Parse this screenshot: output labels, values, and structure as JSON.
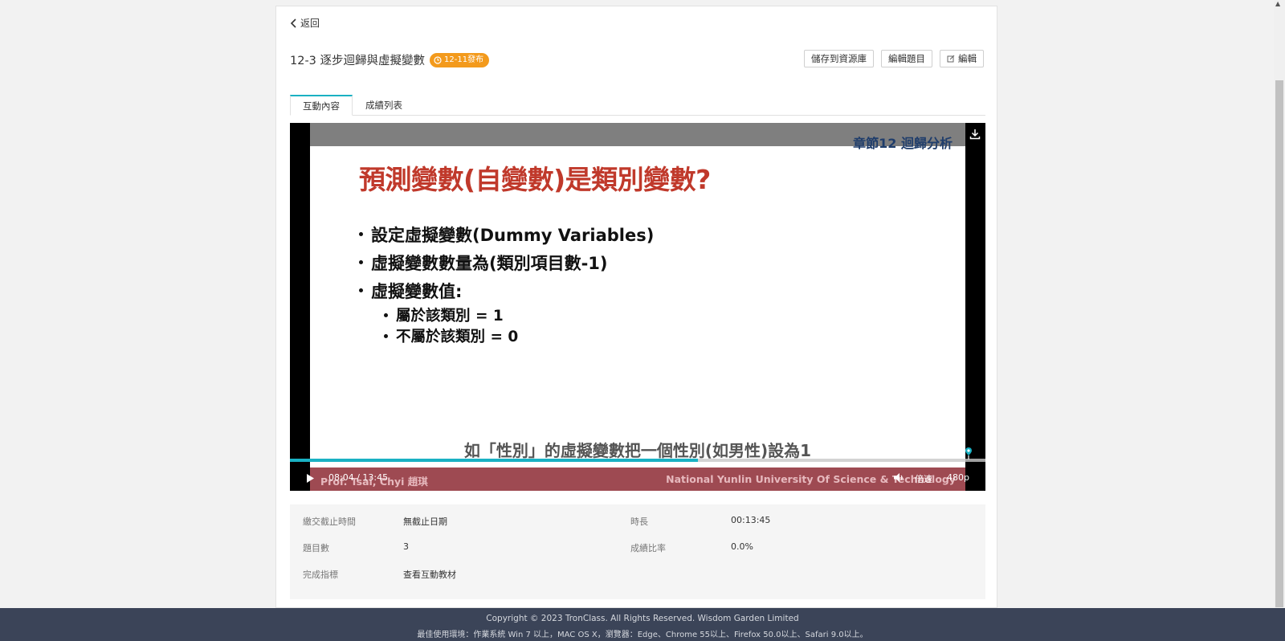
{
  "nav": {
    "back_label": "返回"
  },
  "activity": {
    "title": "12-3 逐步迴歸與虛擬變數",
    "badge": "12-11發布"
  },
  "actions": {
    "save_to_library": "儲存到資源庫",
    "edit_questions": "編輯題目",
    "edit": "編輯"
  },
  "tabs": [
    {
      "label": "互動內容",
      "active": true
    },
    {
      "label": "成績列表",
      "active": false
    }
  ],
  "video": {
    "slide": {
      "chapter": "章節12 迴歸分析",
      "heading": "預測變數(自變數)是類別變數?",
      "bullets": [
        "設定虛擬變數(Dummy Variables)",
        "虛擬變數數量為(類別項目數-1)",
        "虛擬變數值:"
      ],
      "sub_bullets": [
        "屬於該類別 = 1",
        "不屬於該類別 = 0"
      ],
      "professor": "Prof. Tsai, Chyi  趙琪",
      "university": "National Yunlin University Of Science & Technology"
    },
    "subtitle": "如「性別」的虛擬變數把一個性別(如男性)設為1",
    "time_display": "08:04 / 13:45",
    "progress": 0.587,
    "speed_label": "倍速",
    "quality_label": "480p"
  },
  "info": {
    "deadline_label": "繳交截止時間",
    "deadline_value": "無截止日期",
    "duration_label": "時長",
    "duration_value": "00:13:45",
    "question_count_label": "題目數",
    "question_count_value": "3",
    "score_ratio_label": "成績比率",
    "score_ratio_value": "0.0%",
    "completion_label": "完成指標",
    "completion_value": "查看互動教材"
  },
  "footer": {
    "copyright": "Copyright © 2023 TronClass. All Rights Reserved. Wisdom Garden Limited",
    "environment": "最佳使用環境：作業系統 Win 7 以上，MAC OS X，瀏覽器：Edge、Chrome 55以上、Firefox 50.0以上、Safari 9.0以上。"
  },
  "colors": {
    "accent": "#1ab1c3",
    "badge": "#f39a1c",
    "footer_bg": "#3b4458",
    "slide_heading": "#c0392b"
  }
}
